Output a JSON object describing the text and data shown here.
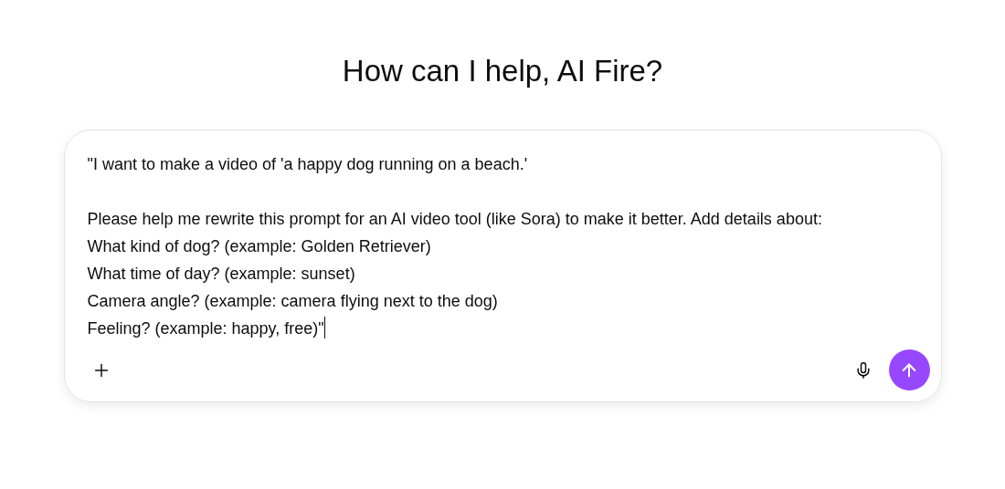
{
  "heading": "How can I help, AI Fire?",
  "composer": {
    "value": "\"I want to make a video of 'a happy dog running on a beach.'\n\nPlease help me rewrite this prompt for an AI video tool (like Sora) to make it better. Add details about:\nWhat kind of dog? (example: Golden Retriever)\nWhat time of day? (example: sunset)\nCamera angle? (example: camera flying next to the dog)\nFeeling? (example: happy, free)\""
  }
}
